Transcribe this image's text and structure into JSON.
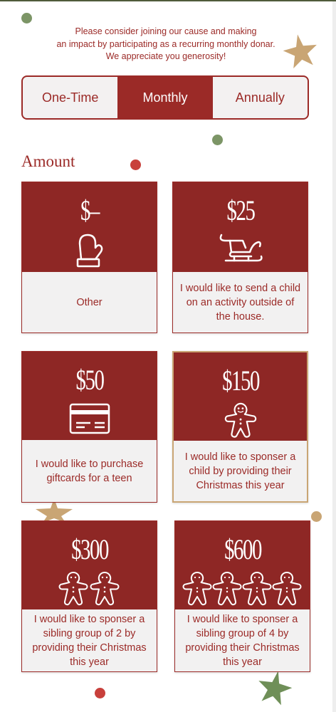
{
  "intro": {
    "line1": "Please consider joining our cause and making",
    "line2": "an impact by participating as a recurring monthly donar.",
    "line3": "We appreciate you generosity!"
  },
  "frequency": {
    "options": [
      "One-Time",
      "Monthly",
      "Annually"
    ],
    "selected": "Monthly"
  },
  "amount_heading": "Amount",
  "cards": [
    {
      "price": "$–",
      "icon": "mitten-icon",
      "description": "Other"
    },
    {
      "price": "$25",
      "icon": "sleigh-icon",
      "description": "I would like to send a child on an activity outside of the house."
    },
    {
      "price": "$50",
      "icon": "gift-card-icon",
      "description": "I would like to purchase giftcards for a teen"
    },
    {
      "price": "$150",
      "icon": "gingerbread-icon",
      "description": "I would like to sponser a child by providing their Christmas this year",
      "selected": true
    },
    {
      "price": "$300",
      "icon": "two-gingerbread-icon",
      "description": "I would like to sponser a sibling group of 2 by providing their Christmas this year"
    },
    {
      "price": "$600",
      "icon": "four-gingerbread-icon",
      "description": "I would like to sponser a sibling group of 4 by providing their Christmas this year"
    }
  ],
  "colors": {
    "primary": "#9b2a27",
    "card_top": "#8e2725",
    "card_bottom": "#f2f1f1",
    "gold": "#c9a574",
    "green": "#6f8f58"
  }
}
